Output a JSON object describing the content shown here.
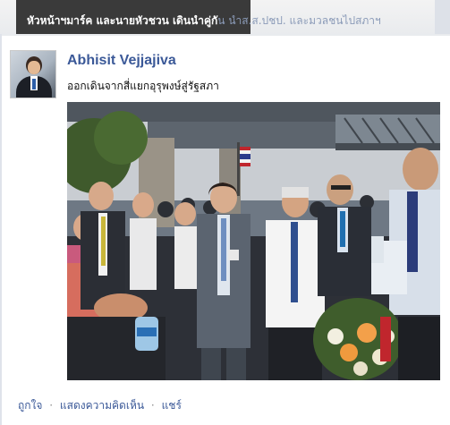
{
  "top_caption": {
    "bold_text": "หัวหน้าฯมาร์ค และนายหัวชวน เดินนำคู่กั",
    "faded_text": "น นำส.ส.ปชป. และมวลชนไปสภาฯ"
  },
  "post": {
    "author": "Abhisit Vejjajiva",
    "message": "ออกเดินจากสี่แยกอุรุพงษ์สู่รัฐสภา"
  },
  "actions": {
    "like": "ถูกใจ",
    "comment": "แสดงความคิดเห็น",
    "share": "แชร์",
    "separator": "·"
  },
  "colors": {
    "link": "#3b5998",
    "caption_bg": "#3a3a3a"
  }
}
